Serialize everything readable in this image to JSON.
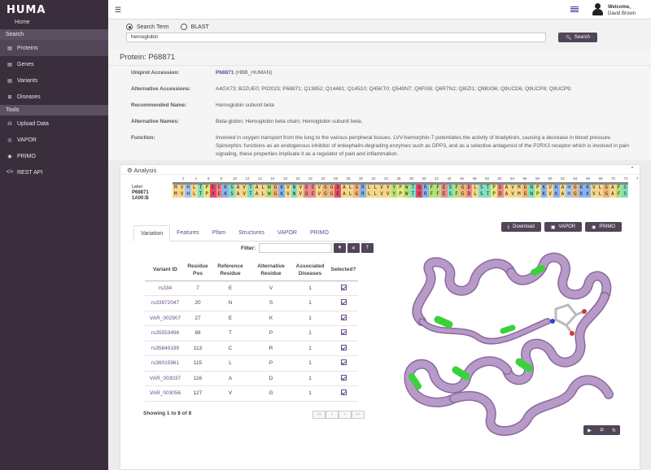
{
  "app": {
    "logo": "HUMA"
  },
  "sidebar": {
    "top_item": "Home",
    "sections": [
      {
        "title": "Search",
        "items": [
          {
            "label": "Proteins",
            "icon": "list-icon",
            "active": true
          },
          {
            "label": "Genes",
            "icon": "list-icon",
            "active": false
          },
          {
            "label": "Variants",
            "icon": "list-icon",
            "active": false
          },
          {
            "label": "Diseases",
            "icon": "list-icon",
            "active": false
          }
        ]
      },
      {
        "title": "Tools",
        "items": [
          {
            "label": "Upload Data",
            "icon": "database-icon"
          },
          {
            "label": "VAPOR",
            "icon": "ring-icon"
          },
          {
            "label": "PRIMO",
            "icon": "eye-icon"
          },
          {
            "label": "REST API",
            "icon": "code-icon"
          }
        ]
      }
    ]
  },
  "header": {
    "welcome": "Welcome,",
    "user": "David Brown"
  },
  "search": {
    "option_term": "Search Term",
    "option_blast": "BLAST",
    "query": "hemoglobin",
    "button": "Search"
  },
  "protein": {
    "title": "Protein: P68871",
    "fields": [
      {
        "label": "Uniprot Accession:",
        "link": "P68871",
        "value": " (HBB_HUMAN)"
      },
      {
        "label": "Alternative Accessions:",
        "value": "A4GX73; B2ZUE0; P02023; P68871; Q13852; Q14481; Q14510; Q45KT0; Q549N7; Q6FI08; Q6R7N2; Q8IZI1; Q9BX96; Q9UCD6; Q9UCP8; Q9UCP9;"
      },
      {
        "label": "Recommended Name:",
        "value": "Hemoglobin subunit beta"
      },
      {
        "label": "Alternative Names:",
        "value": "Beta-globin; Hemoglobin beta chain; Hemoglobin subunit beta;"
      },
      {
        "label": "Function:",
        "value": "Involved in oxygen transport from the lung to the various peripheral tissues. LVV-hemorphin-7 potentiates the activity of bradykinin, causing a decrease in blood pressure. Spinorphin: functions as an endogenous inhibitor of enkephalin-degrading enzymes such as DPP3, and as a selective antagonist of the P2RX3 receptor which is involved in pain signaling, these properties implicate it as a regulator of pain and inflammation."
      }
    ]
  },
  "analysis": {
    "title": "Analysis",
    "sequence": {
      "label_header": "Label",
      "row1_label": "P68871",
      "row2_label": "1A00:B",
      "row1": "MVHLTPEEKSAVTALWGKVNVDEVGGEALGRLLVVYPWTQRFFESFGDLSTPDAVMGNPKVKAHGKKVLGAFS",
      "row2": "MVHLTPVEKSAVTALWGKVNVDEVGGEALGRLLVVYPWTQRFFESFGDLSTPDAVMGNPKVKAHGKKVLGAFS",
      "ruler": [
        "2",
        "4",
        "6",
        "8",
        "10",
        "12",
        "14",
        "16",
        "18",
        "20",
        "22",
        "24",
        "26",
        "28",
        "30",
        "32",
        "34",
        "36",
        "38",
        "40",
        "42",
        "44",
        "46",
        "48",
        "50",
        "52",
        "54",
        "56",
        "58",
        "60",
        "62",
        "64",
        "66",
        "68",
        "70",
        "72",
        "7"
      ],
      "buttons": [
        "Download",
        "VAPOR",
        "PRIMO"
      ]
    },
    "tabs": [
      "Variation",
      "Features",
      "Pfam",
      "Structures",
      "VAPOR",
      "PRIMO"
    ],
    "filter_label": "Filter:",
    "table": {
      "headers": [
        "Variant ID",
        "Residue Pos",
        "Reference Residue",
        "Alternative Residue",
        "Associated Diseases",
        "Selected?"
      ],
      "rows": [
        [
          "rs334",
          "7",
          "E",
          "V",
          "1"
        ],
        [
          "rs33972047",
          "20",
          "N",
          "S",
          "1"
        ],
        [
          "VAR_002907",
          "27",
          "E",
          "K",
          "1"
        ],
        [
          "rs35553496",
          "88",
          "T",
          "P",
          "1"
        ],
        [
          "rs35849199",
          "113",
          "C",
          "R",
          "1"
        ],
        [
          "rs36015961",
          "115",
          "L",
          "P",
          "1"
        ],
        [
          "VAR_003037",
          "116",
          "A",
          "D",
          "1"
        ],
        [
          "VAR_003056",
          "127",
          "V",
          "G",
          "1"
        ]
      ]
    },
    "showing": "Showing 1 to 8 of 8",
    "pager": [
      "<<",
      "<",
      ">",
      ">>"
    ]
  }
}
